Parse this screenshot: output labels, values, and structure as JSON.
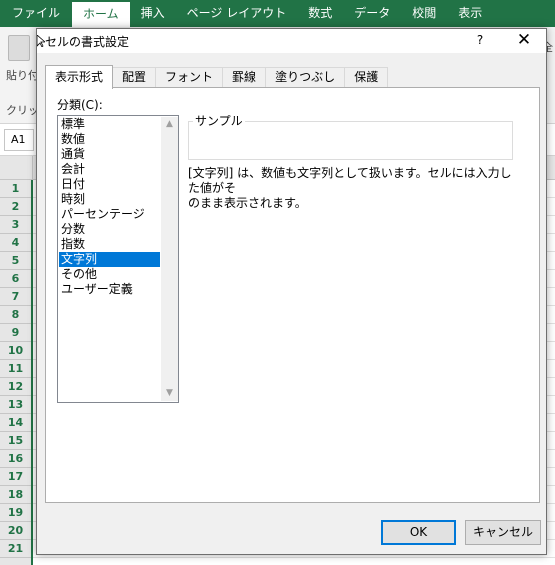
{
  "excel": {
    "ribbon_tabs": [
      "ファイル",
      "ホーム",
      "挿入",
      "ページ レイアウト",
      "数式",
      "データ",
      "校閲",
      "表示"
    ],
    "active_tab_index": 1,
    "paste_label": "貼り付け",
    "clipboard_label": "クリップボ",
    "right_fragment": "全",
    "name_box": "A1",
    "row_headers": [
      "1",
      "2",
      "3",
      "4",
      "5",
      "6",
      "7",
      "8",
      "9",
      "10",
      "11",
      "12",
      "13",
      "14",
      "15",
      "16",
      "17",
      "18",
      "19",
      "20",
      "21"
    ],
    "accent_color": "#217346"
  },
  "dialog": {
    "title": "セルの書式設定",
    "help": "?",
    "close": "✕",
    "tabs": [
      "表示形式",
      "配置",
      "フォント",
      "罫線",
      "塗りつぶし",
      "保護"
    ],
    "active_tab_index": 0,
    "category_label": "分類(C):",
    "categories": [
      "標準",
      "数値",
      "通貨",
      "会計",
      "日付",
      "時刻",
      "パーセンテージ",
      "分数",
      "指数",
      "文字列",
      "その他",
      "ユーザー定義"
    ],
    "selected_category_index": 9,
    "sample_label": "サンプル",
    "description_line1": "[文字列] は、数値も文字列として扱います。セルには入力した値がそ",
    "description_line2": "のまま表示されます。",
    "ok_label": "OK",
    "cancel_label": "キャンセル",
    "selection_color": "#0078d7"
  }
}
